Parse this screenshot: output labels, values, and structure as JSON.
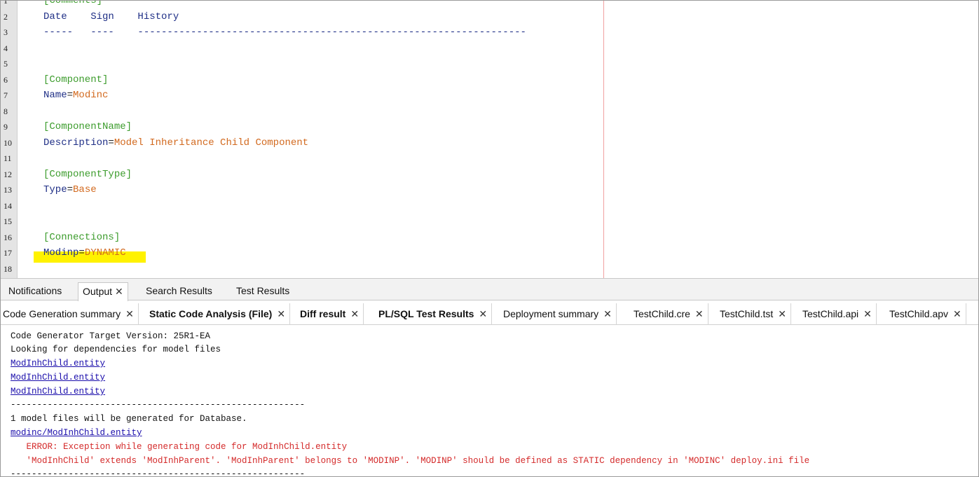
{
  "editor": {
    "lines": [
      {
        "n": "1",
        "parts": [
          {
            "t": "[Comments]",
            "k": "sec"
          }
        ]
      },
      {
        "n": "2",
        "parts": [
          {
            "t": "Date    Sign    History",
            "k": "key"
          }
        ]
      },
      {
        "n": "3",
        "parts": [
          {
            "t": "-----   ----    ------------------------------------------------------------------",
            "k": "dash"
          }
        ]
      },
      {
        "n": "4",
        "parts": []
      },
      {
        "n": "5",
        "parts": []
      },
      {
        "n": "6",
        "parts": [
          {
            "t": "[Component]",
            "k": "sec"
          }
        ]
      },
      {
        "n": "7",
        "parts": [
          {
            "t": "Name",
            "k": "key"
          },
          {
            "t": "=",
            "k": "eq"
          },
          {
            "t": "Modinc",
            "k": "val"
          }
        ]
      },
      {
        "n": "8",
        "parts": []
      },
      {
        "n": "9",
        "parts": [
          {
            "t": "[ComponentName]",
            "k": "sec"
          }
        ]
      },
      {
        "n": "10",
        "parts": [
          {
            "t": "Description",
            "k": "key"
          },
          {
            "t": "=",
            "k": "eq"
          },
          {
            "t": "Model Inheritance Child Component",
            "k": "val"
          }
        ]
      },
      {
        "n": "11",
        "parts": []
      },
      {
        "n": "12",
        "parts": [
          {
            "t": "[ComponentType]",
            "k": "sec"
          }
        ]
      },
      {
        "n": "13",
        "parts": [
          {
            "t": "Type",
            "k": "key"
          },
          {
            "t": "=",
            "k": "eq"
          },
          {
            "t": "Base",
            "k": "val"
          }
        ]
      },
      {
        "n": "14",
        "parts": []
      },
      {
        "n": "15",
        "parts": []
      },
      {
        "n": "16",
        "parts": [
          {
            "t": "[Connections]",
            "k": "sec"
          }
        ]
      },
      {
        "n": "17",
        "parts": [
          {
            "t": "Modinp",
            "k": "key"
          },
          {
            "t": "=",
            "k": "eq"
          },
          {
            "t": "DYNAMIC",
            "k": "val"
          }
        ]
      },
      {
        "n": "18",
        "parts": []
      }
    ]
  },
  "panel_tabs": [
    {
      "label": "Notifications",
      "active": false,
      "closable": false
    },
    {
      "label": "Output",
      "active": true,
      "closable": true
    },
    {
      "label": "Search Results",
      "active": false,
      "closable": false
    },
    {
      "label": "Test Results",
      "active": false,
      "closable": false
    }
  ],
  "sub_tabs": [
    {
      "label": "Code Generation summary",
      "bold": false
    },
    {
      "label": "Static Code Analysis (File)",
      "bold": true
    },
    {
      "label": "Diff result",
      "bold": true
    },
    {
      "label": "PL/SQL Test Results",
      "bold": true
    },
    {
      "label": "Deployment summary",
      "bold": false
    },
    {
      "label": "TestChild.cre",
      "bold": false
    },
    {
      "label": "TestChild.tst",
      "bold": false
    },
    {
      "label": "TestChild.api",
      "bold": false
    },
    {
      "label": "TestChild.apv",
      "bold": false
    }
  ],
  "close_glyph": "✕",
  "output": {
    "lines": [
      {
        "t": "Code Generator Target Version: 25R1-EA",
        "k": "text"
      },
      {
        "t": "Looking for dependencies for model files",
        "k": "text"
      },
      {
        "t": "ModInhChild.entity",
        "k": "link"
      },
      {
        "t": "ModInhChild.entity",
        "k": "link"
      },
      {
        "t": "ModInhChild.entity",
        "k": "link"
      },
      {
        "t": "--------------------------------------------------------",
        "k": "text"
      },
      {
        "t": "1 model files will be generated for Database.",
        "k": "text"
      },
      {
        "t": "modinc/ModInhChild.entity",
        "k": "link"
      },
      {
        "t": "   ERROR: Exception while generating code for ModInhChild.entity",
        "k": "error"
      },
      {
        "t": "   'ModInhChild' extends 'ModInhParent'. 'ModInhParent' belongs to 'MODINP'. 'MODINP' should be defined as STATIC dependency in 'MODINC' deploy.ini file",
        "k": "error"
      },
      {
        "t": "--------------------------------------------------------",
        "k": "text"
      }
    ]
  },
  "colors": {
    "section": "#3c9c2c",
    "key": "#1f2f86",
    "value": "#d2691e",
    "highlight": "#fff200",
    "link": "#1a0dab",
    "error": "#d42a2a"
  }
}
